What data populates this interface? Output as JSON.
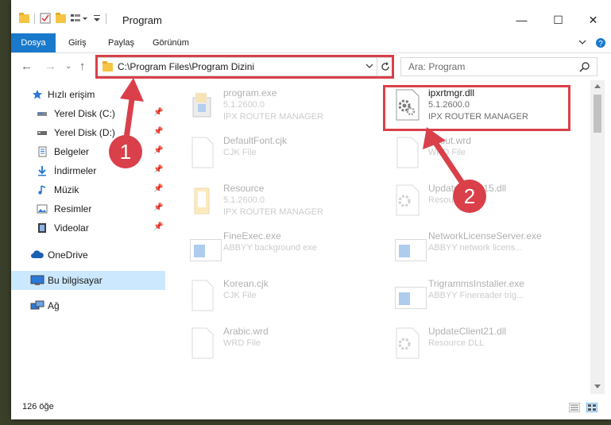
{
  "window": {
    "title": "Program",
    "controls": {
      "minimize": "—",
      "maximize": "☐",
      "close": "✕"
    }
  },
  "ribbon": {
    "tabs": [
      "Dosya",
      "Giriş",
      "Paylaş",
      "Görünüm"
    ]
  },
  "address": {
    "path": "C:\\Program Files\\Program Dizini"
  },
  "search": {
    "placeholder": "Ara: Program"
  },
  "sidebar": {
    "items": [
      {
        "label": "Hızlı erişim",
        "icon": "star-icon",
        "pinned": false
      },
      {
        "label": "Yerel Disk (C:)",
        "icon": "drive-icon",
        "pinned": true
      },
      {
        "label": "Yerel Disk (D:)",
        "icon": "drive-icon",
        "pinned": true
      },
      {
        "label": "Belgeler",
        "icon": "documents-icon",
        "pinned": true
      },
      {
        "label": "İndirmeler",
        "icon": "download-icon",
        "pinned": true
      },
      {
        "label": "Müzik",
        "icon": "music-icon",
        "pinned": true
      },
      {
        "label": "Resimler",
        "icon": "pictures-icon",
        "pinned": true
      },
      {
        "label": "Videolar",
        "icon": "video-icon",
        "pinned": true
      },
      {
        "label": "OneDrive",
        "icon": "cloud-icon",
        "pinned": false
      },
      {
        "label": "Bu bilgisayar",
        "icon": "computer-icon",
        "pinned": false,
        "selected": true
      },
      {
        "label": "Ağ",
        "icon": "network-icon",
        "pinned": false
      }
    ]
  },
  "files": [
    {
      "name": "program.exe",
      "line2": "5.1.2600.0",
      "line3": "IPX ROUTER MANAGER",
      "icon": "exe-icon",
      "highlighted": false
    },
    {
      "name": "ipxrtmgr.dll",
      "line2": "5.1.2600.0",
      "line3": "IPX ROUTER MANAGER",
      "icon": "dll-gear-icon",
      "highlighted": true
    },
    {
      "name": "DefaultFont.cjk",
      "line2": "CJK File",
      "line3": "",
      "icon": "document-icon",
      "highlighted": false
    },
    {
      "name": "About.wrd",
      "line2": "WRD File",
      "line3": "",
      "icon": "document-icon",
      "highlighted": false
    },
    {
      "name": "Resource",
      "line2": "5.1.2600.0",
      "line3": "IPX ROUTER MANAGER",
      "icon": "folder-icon",
      "highlighted": false
    },
    {
      "name": "UpdateClient15.dll",
      "line2": "Resource DLL",
      "line3": "",
      "icon": "dll-gear-icon",
      "highlighted": false
    },
    {
      "name": "FineExec.exe",
      "line2": "ABBYY background exe",
      "line3": "",
      "icon": "app-window-icon",
      "highlighted": false
    },
    {
      "name": "NetworkLicenseServer.exe",
      "line2": "ABBYY network licens...",
      "line3": "",
      "icon": "app-window-icon",
      "highlighted": false
    },
    {
      "name": "Korean.cjk",
      "line2": "CJK File",
      "line3": "",
      "icon": "document-icon",
      "highlighted": false
    },
    {
      "name": "TrigrammsInstaller.exe",
      "line2": "ABBYY Finereader trig...",
      "line3": "",
      "icon": "app-window-icon",
      "highlighted": false
    },
    {
      "name": "Arabic.wrd",
      "line2": "WRD File",
      "line3": "",
      "icon": "document-icon",
      "highlighted": false
    },
    {
      "name": "UpdateClient21.dll",
      "line2": "Resource DLL",
      "line3": "",
      "icon": "dll-gear-icon",
      "highlighted": false
    }
  ],
  "status": {
    "count": "126 öğe"
  },
  "annotations": [
    {
      "number": "1",
      "color": "#d9404a"
    },
    {
      "number": "2",
      "color": "#d9404a"
    }
  ],
  "colors": {
    "accent": "#1979ca",
    "selection": "#cce8ff",
    "annotation": "#d9404a"
  }
}
